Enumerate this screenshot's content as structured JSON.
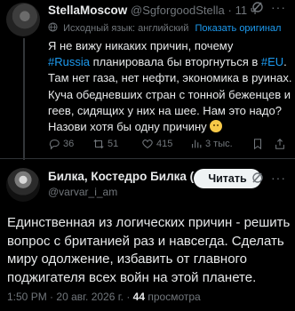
{
  "tweet1": {
    "display_name": "StellaMoscow",
    "handle": "@SgforgoodStella",
    "dot": "·",
    "time": "11 ч",
    "more": "···",
    "translation_note": "Исходный язык: английский",
    "show_original": "Показать оригинал",
    "lines": [
      [
        "Я не вижу никаких причин, почему"
      ],
      [
        "",
        "#Russia",
        " планировала бы вторгнуться в ",
        "#EU",
        "."
      ],
      [
        "Там нет газа, нет нефти, экономика в руинах."
      ],
      [
        "Куча обедневших стран с тонной беженцев и"
      ],
      [
        "геев, сидящих у них на шее. Нам это надо?"
      ],
      [
        "Назови хотя бы одну причину "
      ]
    ],
    "replies": "36",
    "reposts": "51",
    "likes": "415",
    "views": "3 тыс.",
    "icons": [
      "reply-icon",
      "repost-icon",
      "like-icon",
      "views-icon",
      "bookmark-icon",
      "share-icon",
      "grok-icon",
      "globe-icon",
      "thinking-face-emoji"
    ]
  },
  "tweet2": {
    "display_name": "Билка, Костедро Билка (...",
    "handle": "@varvar_i_am",
    "follow_label": "Читать",
    "more": "···",
    "lines": [
      "Единственная из логических причин - решить",
      "вопрос с британией раз и навсегда. Сделать",
      "миру одолжение, избавить от главного",
      "поджигателя всех войн на этой планете."
    ],
    "time": "1:50 PM",
    "date": "20 авг. 2026 г.",
    "views": "44",
    "views_label": "просмотра",
    "dot": "·"
  },
  "colors": {
    "accent": "#1d9bf0",
    "text": "#e7e9ea",
    "muted": "#71767b",
    "background": "#000000"
  }
}
